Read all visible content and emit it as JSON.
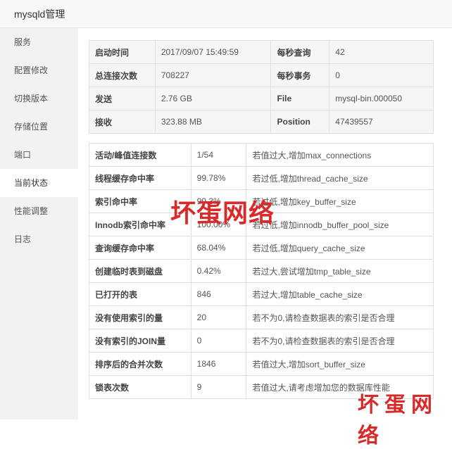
{
  "window": {
    "title": "mysqld管理"
  },
  "sidebar": {
    "items": [
      {
        "label": "服务",
        "active": false
      },
      {
        "label": "配置修改",
        "active": false
      },
      {
        "label": "切换版本",
        "active": false
      },
      {
        "label": "存储位置",
        "active": false
      },
      {
        "label": "端口",
        "active": false
      },
      {
        "label": "当前状态",
        "active": true
      },
      {
        "label": "性能调整",
        "active": false
      },
      {
        "label": "日志",
        "active": false
      }
    ]
  },
  "status": {
    "rows": [
      {
        "k1": "启动时间",
        "v1": "2017/09/07 15:49:59",
        "k2": "每秒查询",
        "v2": "42"
      },
      {
        "k1": "总连接次数",
        "v1": "708227",
        "k2": "每秒事务",
        "v2": "0"
      },
      {
        "k1": "发送",
        "v1": "2.76 GB",
        "k2": "File",
        "v2": "mysql-bin.000050"
      },
      {
        "k1": "接收",
        "v1": "323.88 MB",
        "k2": "Position",
        "v2": "47439557"
      }
    ]
  },
  "metrics": {
    "rows": [
      {
        "name": "活动/峰值连接数",
        "value": "1/54",
        "advice": "若值过大,增加max_connections"
      },
      {
        "name": "线程缓存命中率",
        "value": "99.78%",
        "advice": "若过低,增加thread_cache_size"
      },
      {
        "name": "索引命中率",
        "value": "99.3%",
        "advice": "若过低,增加key_buffer_size"
      },
      {
        "name": "Innodb索引命中率",
        "value": "100.00%",
        "advice": "若过低,增加innodb_buffer_pool_size"
      },
      {
        "name": "查询缓存命中率",
        "value": "68.04%",
        "advice": "若过低,增加query_cache_size"
      },
      {
        "name": "创建临时表到磁盘",
        "value": "0.42%",
        "advice": "若过大,尝试增加tmp_table_size"
      },
      {
        "name": "已打开的表",
        "value": "846",
        "advice": "若过大,增加table_cache_size"
      },
      {
        "name": "没有使用索引的量",
        "value": "20",
        "advice": "若不为0,请检查数据表的索引是否合理"
      },
      {
        "name": "没有索引的JOIN量",
        "value": "0",
        "advice": "若不为0,请检查数据表的索引是否合理"
      },
      {
        "name": "排序后的合并次数",
        "value": "1846",
        "advice": "若值过大,增加sort_buffer_size"
      },
      {
        "name": "锁表次数",
        "value": "9",
        "advice": "若值过大,请考虑增加您的数据库性能"
      }
    ]
  },
  "watermarks": {
    "center": "坏蛋网络",
    "corner": "坏蛋网络"
  }
}
